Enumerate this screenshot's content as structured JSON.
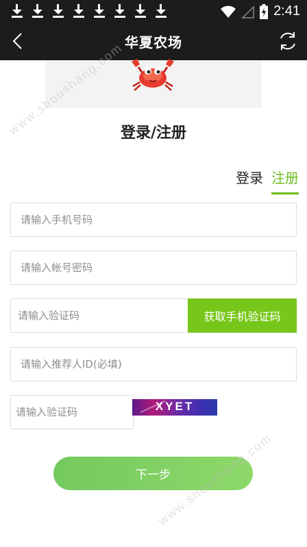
{
  "statusbar": {
    "time": "2:41",
    "download_icons": 8,
    "icons": [
      "download-icon",
      "wifi-icon",
      "signal-icon",
      "battery-icon"
    ]
  },
  "navbar": {
    "title": "华夏农场",
    "back_icon": "chevron-left-icon",
    "refresh_icon": "refresh-icon"
  },
  "page": {
    "heading": "登录/注册",
    "logo_icon": "crab-icon"
  },
  "tabs": [
    {
      "label": "登录",
      "active": false
    },
    {
      "label": "注册",
      "active": true
    }
  ],
  "form": {
    "phone_placeholder": "请输入手机号码",
    "password_placeholder": "请输入帐号密码",
    "sms_code_placeholder": "请输入验证码",
    "sms_button": "获取手机验证码",
    "referrer_placeholder": "请输入推荐人ID(必填)",
    "captcha_placeholder": "请输入验证码",
    "captcha_text": "XYET",
    "next_button": "下一步"
  },
  "watermark": {
    "text_top": "www.shoushang.com",
    "text_bottom": "www.shoushang.com"
  },
  "colors": {
    "accent": "#77c71a",
    "header_bg": "#1c1c1c",
    "next_button": "#80cf64"
  }
}
